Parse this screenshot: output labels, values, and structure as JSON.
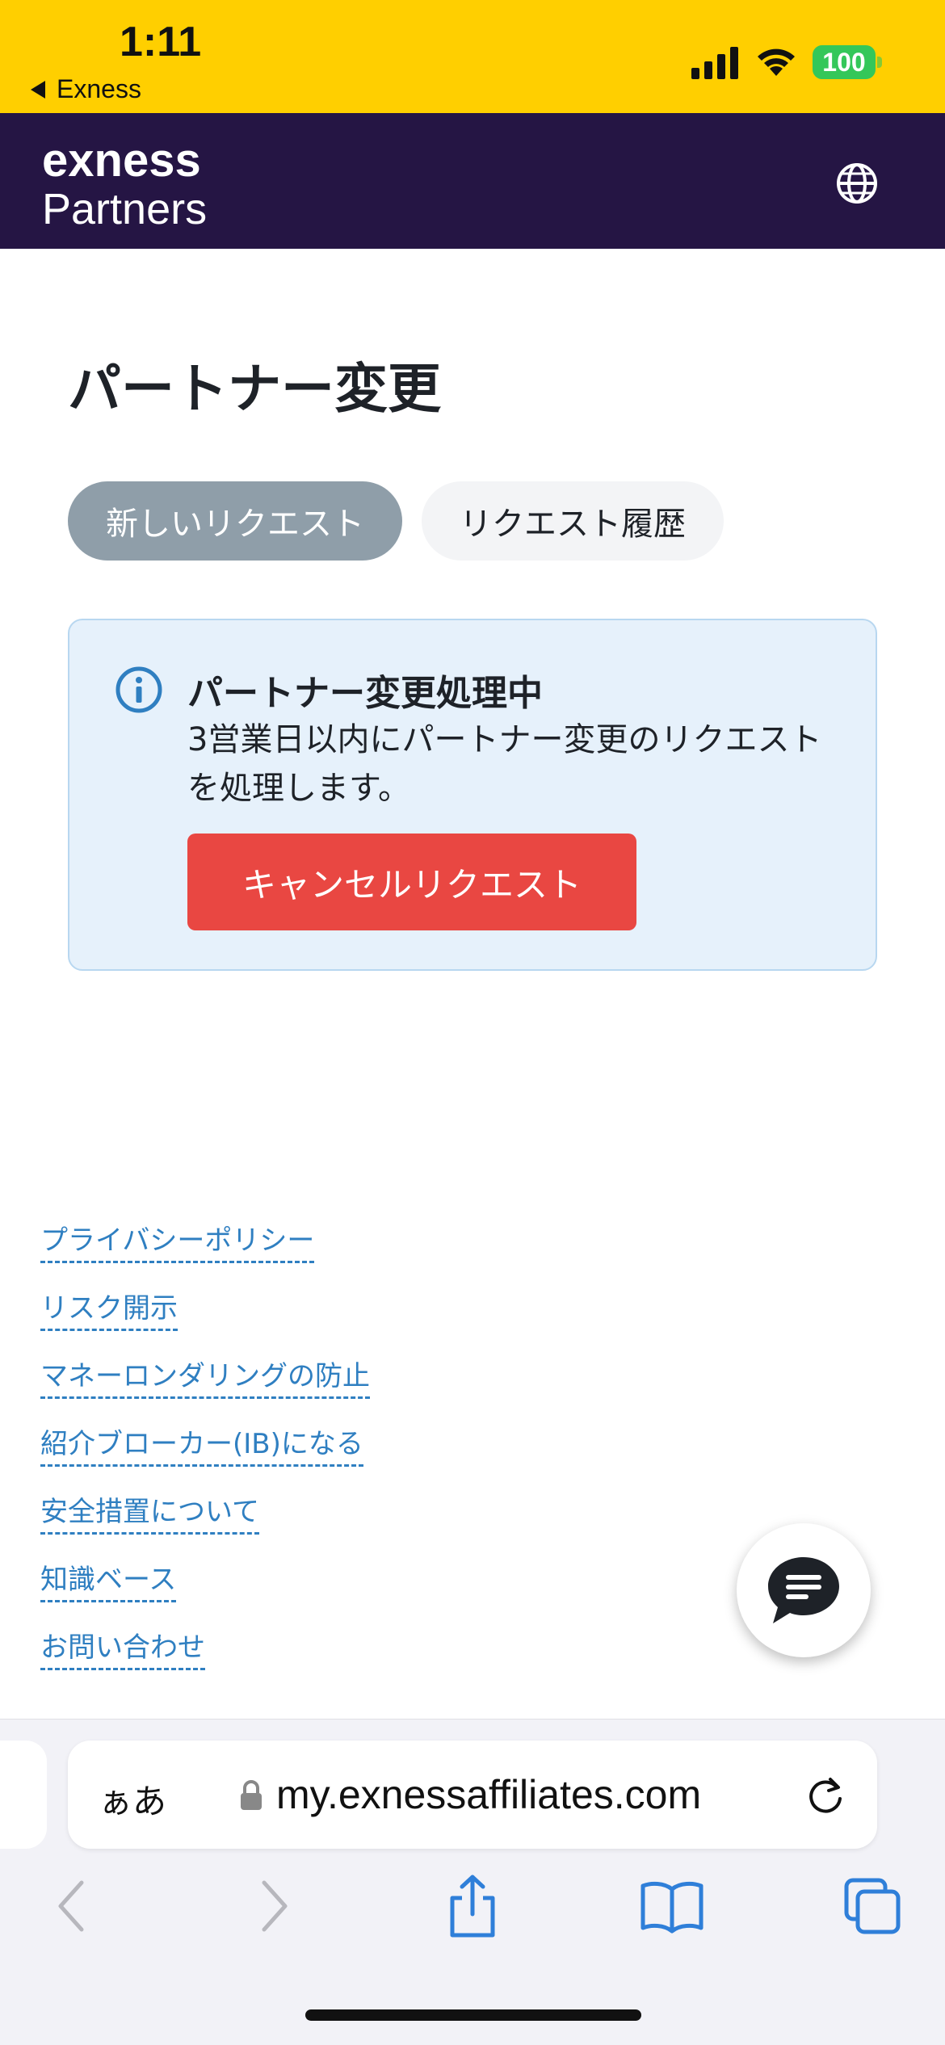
{
  "status_bar": {
    "time": "1:11",
    "back_label": "Exness",
    "battery": "100"
  },
  "header": {
    "logo_top": "exness",
    "logo_bottom": "Partners"
  },
  "page": {
    "title": "パートナー変更",
    "tabs": [
      {
        "label": "新しいリクエスト",
        "active": true
      },
      {
        "label": "リクエスト履歴",
        "active": false
      }
    ]
  },
  "notice": {
    "title": "パートナー変更処理中",
    "text": "3営業日以内にパートナー変更のリクエストを処理します。",
    "cancel_label": "キャンセルリクエスト"
  },
  "footer": {
    "links": [
      "プライバシーポリシー",
      "リスク開示",
      "マネーロンダリングの防止",
      "紹介ブローカー(IB)になる",
      "安全措置について",
      "知識ベース",
      "お問い合わせ"
    ]
  },
  "browser": {
    "aa_label": "ぁあ",
    "url": "my.exnessaffiliates.com"
  },
  "colors": {
    "status_bar": "#ffcf00",
    "header": "#251544",
    "active_tab": "#8f9ea9",
    "notice_bg": "#e6f1fb",
    "cancel_button": "#e94742",
    "link": "#2f7fc1"
  }
}
